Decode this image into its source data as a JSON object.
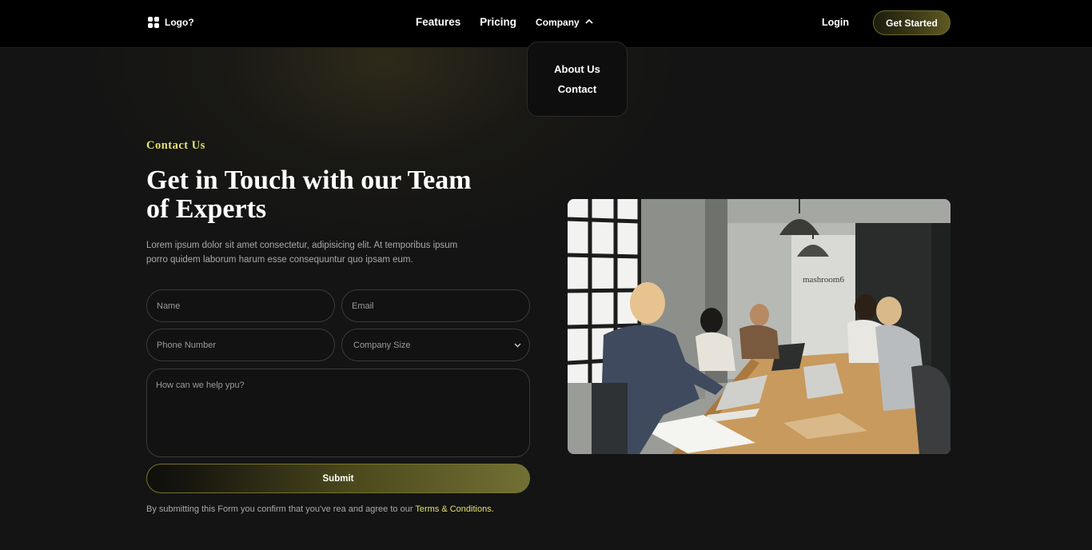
{
  "nav": {
    "logo_text": "Logo?",
    "links": [
      "Features",
      "Pricing"
    ],
    "company_label": "Company",
    "login_label": "Login",
    "cta_label": "Get Started"
  },
  "dropdown": {
    "items": [
      "About Us",
      "Contact"
    ]
  },
  "hero": {
    "eyebrow": "Contact Us",
    "headline": "Get in Touch with our Team of Experts",
    "lead": "Lorem ipsum dolor sit amet consectetur, adipisicing elit. At temporibus ipsum porro quidem laborum harum esse consequuntur quo ipsam eum."
  },
  "form": {
    "name_placeholder": "Name",
    "email_placeholder": "Email",
    "phone_placeholder": "Phone Number",
    "company_size_placeholder": "Company Size",
    "message_placeholder": "How can we help ypu?",
    "submit_label": "Submit",
    "terms_text": "By submitting this Form you confirm that you've rea and agree to our ",
    "terms_link": "Terms & Conditions."
  },
  "photo": {
    "wall_sign": "mashroom6"
  },
  "colors": {
    "accent": "#e2e070",
    "background": "#141414",
    "nav_background": "#000000"
  }
}
